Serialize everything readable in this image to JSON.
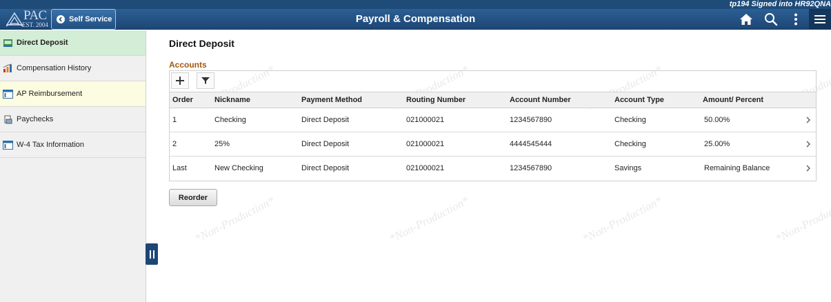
{
  "header": {
    "signed_in": "tp194 Signed into HR92QNA",
    "logo_text": "PAC",
    "logo_sub": "EST. 2004",
    "back_label": "Self Service",
    "title": "Payroll & Compensation",
    "icons": [
      "home-icon",
      "search-icon",
      "more-vert-icon",
      "hamburger-menu-icon"
    ]
  },
  "sidebar": {
    "items": [
      {
        "label": "Direct Deposit",
        "icon": "bank-icon",
        "state": "active"
      },
      {
        "label": "Compensation History",
        "icon": "chart-icon",
        "state": "normal"
      },
      {
        "label": "AP Reimbursement",
        "icon": "form-icon",
        "state": "hover"
      },
      {
        "label": "Paychecks",
        "icon": "paycheck-icon",
        "state": "normal"
      },
      {
        "label": "W-4 Tax Information",
        "icon": "form-icon",
        "state": "normal"
      }
    ]
  },
  "main": {
    "title": "Direct Deposit",
    "section": "Accounts",
    "columns": [
      "Order",
      "Nickname",
      "Payment Method",
      "Routing Number",
      "Account Number",
      "Account Type",
      "Amount/ Percent"
    ],
    "rows": [
      [
        "1",
        "Checking",
        "Direct Deposit",
        "021000021",
        "1234567890",
        "Checking",
        "50.00%"
      ],
      [
        "2",
        "25%",
        "Direct Deposit",
        "021000021",
        "4444545444",
        "Checking",
        "25.00%"
      ],
      [
        "Last",
        "New Checking",
        "Direct Deposit",
        "021000021",
        "1234567890",
        "Savings",
        "Remaining Balance"
      ]
    ],
    "reorder_label": "Reorder",
    "watermark": "*Non-Production*"
  },
  "colors": {
    "header": "#1d4675",
    "active_nav": "#d3edd7",
    "hover_nav": "#fcfce0",
    "section_label": "#a25a12"
  }
}
